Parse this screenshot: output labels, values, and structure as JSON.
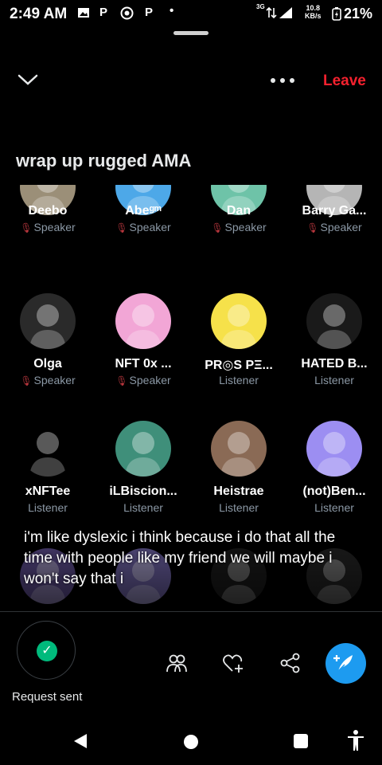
{
  "status_bar": {
    "time": "2:49 AM",
    "app_icons": [
      "photo-icon",
      "p-icon",
      "whatsapp-icon",
      "p-icon",
      "dot-icon"
    ],
    "network": "3G",
    "net_speed_value": "10.8",
    "net_speed_unit": "KB/s",
    "battery": "21%"
  },
  "header": {
    "leave_label": "Leave",
    "title": "wrap up rugged AMA"
  },
  "participants": [
    {
      "name": "Deebo",
      "role": "Speaker",
      "muted": true,
      "avatar_color": "#9b8f78"
    },
    {
      "name": "Abeᵍᵐ",
      "role": "Speaker",
      "muted": true,
      "avatar_color": "#4da8e8"
    },
    {
      "name": "Dan",
      "role": "Speaker",
      "muted": true,
      "avatar_color": "#6ec3a8"
    },
    {
      "name": "Barry Ga...",
      "role": "Speaker",
      "muted": true,
      "avatar_color": "#b5b5b5"
    },
    {
      "name": "Olga",
      "role": "Speaker",
      "muted": true,
      "avatar_color": "#2a2a2a"
    },
    {
      "name": "NFT 0x ...",
      "role": "Speaker",
      "muted": true,
      "avatar_color": "#f2a6d6"
    },
    {
      "name": "PR◎S PΞ...",
      "role": "Listener",
      "muted": false,
      "avatar_color": "#f6e14a"
    },
    {
      "name": "HATED B...",
      "role": "Listener",
      "muted": false,
      "avatar_color": "#1a1a1a"
    },
    {
      "name": "xNFTee",
      "role": "Listener",
      "muted": false,
      "avatar_color": "#000000"
    },
    {
      "name": "iLBiscion...",
      "role": "Listener",
      "muted": false,
      "avatar_color": "#3f8f7a"
    },
    {
      "name": "Heistrae",
      "role": "Listener",
      "muted": false,
      "avatar_color": "#8a6a55"
    },
    {
      "name": "(not)Ben...",
      "role": "Listener",
      "muted": false,
      "avatar_color": "#9c8ef2"
    },
    {
      "name": "",
      "role": "",
      "muted": false,
      "avatar_color": "#5a4a8a"
    },
    {
      "name": "",
      "role": "",
      "muted": false,
      "avatar_color": "#6a5fa0"
    },
    {
      "name": "",
      "role": "",
      "muted": false,
      "avatar_color": "#1a1a1a"
    },
    {
      "name": "",
      "role": "",
      "muted": false,
      "avatar_color": "#222222"
    }
  ],
  "caption": "i'm like dyslexic i think because i do that all the time with people like my friend we will maybe i won't say that i",
  "bottom_bar": {
    "request_label": "Request sent",
    "actions": [
      "people-icon",
      "heart-plus-icon",
      "share-icon",
      "compose-icon"
    ]
  },
  "colors": {
    "leave": "#f4212e",
    "accent": "#1d9bf0",
    "success": "#00ba7c",
    "muted_text": "#8b98a5"
  }
}
